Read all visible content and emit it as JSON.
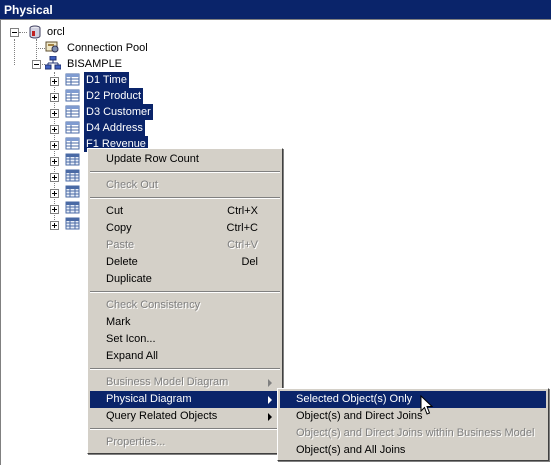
{
  "panel": {
    "title": "Physical"
  },
  "tree": {
    "root": {
      "label": "orcl",
      "icon": "database-icon"
    },
    "connection_pool": {
      "label": "Connection Pool",
      "icon": "connection-pool-icon"
    },
    "schema": {
      "label": "BISAMPLE",
      "icon": "schema-icon"
    },
    "tables": [
      {
        "label": "D1 Time",
        "selected": true,
        "icon": "alias-table-icon"
      },
      {
        "label": "D2 Product",
        "selected": true,
        "icon": "alias-table-icon"
      },
      {
        "label": "D3 Customer",
        "selected": true,
        "icon": "alias-table-icon"
      },
      {
        "label": "D4 Address",
        "selected": true,
        "icon": "alias-table-icon"
      },
      {
        "label": "F1 Revenue",
        "selected": true,
        "icon": "alias-table-icon"
      },
      {
        "label": "",
        "icon": "physical-table-icon"
      },
      {
        "label": "",
        "icon": "physical-table-icon"
      },
      {
        "label": "",
        "icon": "physical-table-icon"
      },
      {
        "label": "",
        "icon": "physical-table-icon"
      },
      {
        "label": "",
        "icon": "physical-table-icon"
      }
    ]
  },
  "context_menu": {
    "update_row_count": "Update Row Count",
    "check_out": "Check Out",
    "cut": "Cut",
    "cut_shortcut": "Ctrl+X",
    "copy": "Copy",
    "copy_shortcut": "Ctrl+C",
    "paste": "Paste",
    "paste_shortcut": "Ctrl+V",
    "delete": "Delete",
    "delete_shortcut": "Del",
    "duplicate": "Duplicate",
    "check_consistency": "Check Consistency",
    "mark": "Mark",
    "set_icon": "Set Icon...",
    "expand_all": "Expand All",
    "business_model_diagram": "Business Model Diagram",
    "physical_diagram": "Physical Diagram",
    "query_related_objects": "Query Related Objects",
    "properties": "Properties..."
  },
  "submenu": {
    "selected_only": "Selected Object(s) Only",
    "direct_joins": "Object(s) and Direct Joins",
    "direct_joins_bm": "Object(s) and Direct Joins within Business Model",
    "all_joins": "Object(s) and All Joins"
  },
  "colors": {
    "selection": "#0a246a",
    "menu_bg": "#d4d0c8",
    "disabled_text": "#808080"
  }
}
